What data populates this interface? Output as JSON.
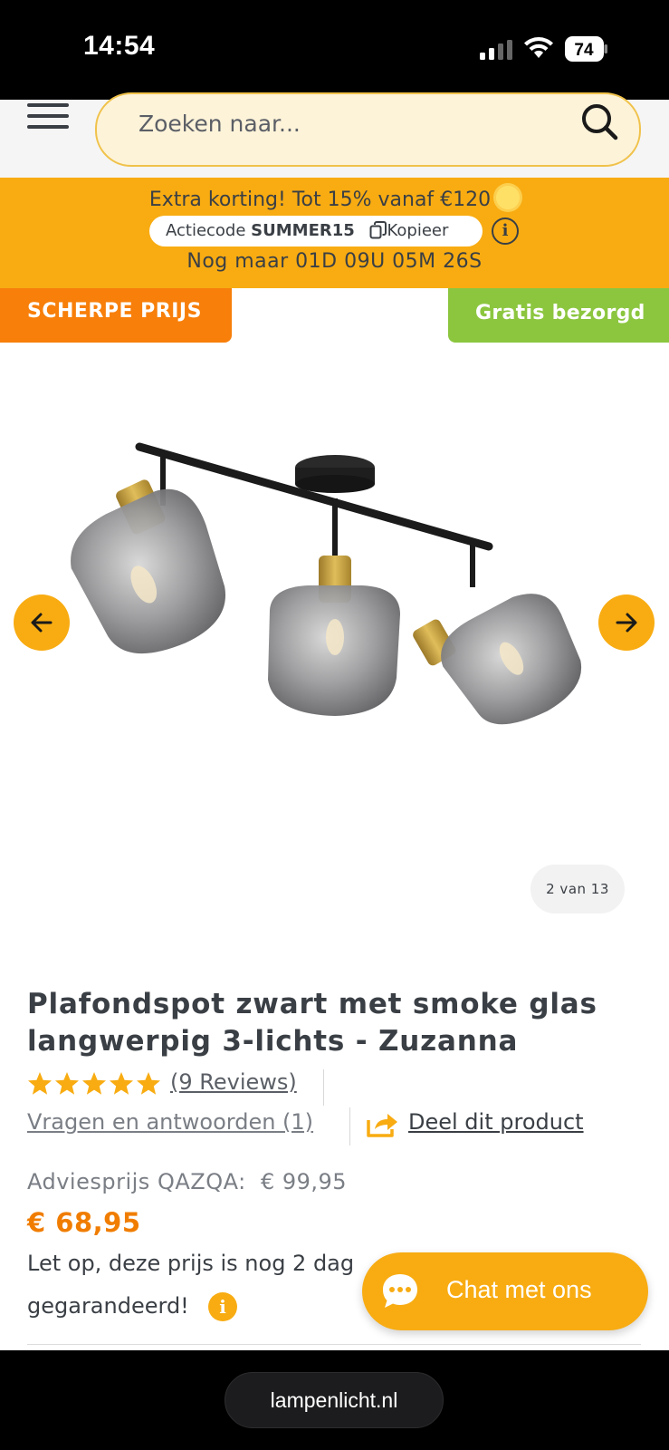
{
  "status_bar": {
    "time": "14:54",
    "battery": "74",
    "icons": [
      "cellular-signal-icon",
      "wifi-icon",
      "battery-icon"
    ]
  },
  "header": {
    "menu_icon": "hamburger-menu-icon",
    "search_placeholder": "Zoeken naar...",
    "search_icon": "search-icon"
  },
  "promo": {
    "line1": "Extra korting! Tot 15% vanaf €120",
    "code_label": "Actiecode",
    "code": "SUMMER15",
    "copy_label": "Kopieer",
    "countdown": "Nog maar 01D 09U 05M 26S",
    "background_color": "#f8ac12"
  },
  "badges": {
    "sharp_price": "SCHERPE PRIJS",
    "free_delivery": "Gratis bezorgd",
    "sharp_color": "#f77f0a",
    "free_color": "#8cc63f"
  },
  "gallery": {
    "counter": "2 van 13",
    "image_subject": "ceiling-spot-lamp-three-smoke-glass-shades"
  },
  "product": {
    "title_line1": "Plafondspot zwart met smoke glas",
    "title_line2": "langwerpig 3-lichts - Zuzanna",
    "rating_stars": 5,
    "reviews_link": "(9 Reviews)",
    "qa_link": "Vragen en antwoorden (1)",
    "share_link": "Deel dit product",
    "advies_label": "Adviesprijs QAZQA:",
    "advies_price": "€ 99,95",
    "price": "€ 68,95",
    "note_line1": "Let op, deze prijs is nog 2 dag",
    "note_line2": "gegarandeerd!",
    "price_color": "#f07d00"
  },
  "chat": {
    "label": "Chat met ons"
  },
  "browser": {
    "url": "lampenlicht.nl"
  }
}
